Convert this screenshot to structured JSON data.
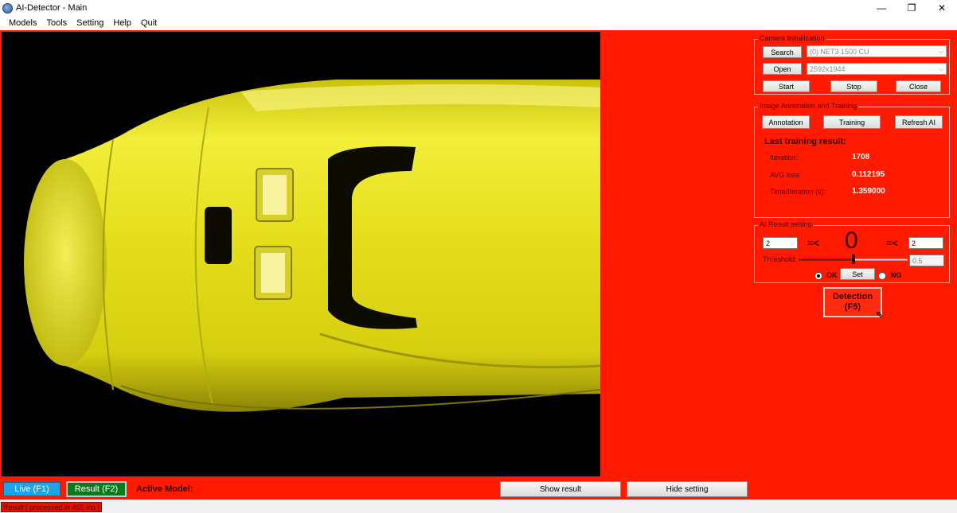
{
  "window": {
    "title": "AI-Detector - Main",
    "minimize": "—",
    "maximize": "❐",
    "close": "✕"
  },
  "menu": [
    "Models",
    "Tools",
    "Setting",
    "Help",
    "Quit"
  ],
  "camera_init": {
    "title": "Camera Initialization",
    "search_label": "Search",
    "open_label": "Open",
    "camera_value": "(0) NET3 1500 CU",
    "resolution_value": "2592x1944",
    "start_label": "Start",
    "stop_label": "Stop",
    "close_label": "Close"
  },
  "annotation": {
    "title": "Image Annotation and Training",
    "annotation_label": "Annotation",
    "training_label": "Training",
    "refresh_label": "Refresh AI",
    "last_result_title": "Last training result:",
    "iteration_label": "Iteration:",
    "iteration_value": "1708",
    "avg_loss_label": "AVG loss:",
    "avg_loss_value": "0.112195",
    "time_label": "Time/Iteration (s):",
    "time_value": "1.359000"
  },
  "ai_result": {
    "title": "AI Result setting",
    "min_value": "2",
    "cmp_left": "=<",
    "count": "0",
    "cmp_right": "=<",
    "max_value": "2",
    "threshold_label": "Threshold:",
    "threshold_value": "0.5",
    "threshold_fraction": 0.5,
    "ok_label": "OK",
    "set_label": "Set",
    "ng_label": "NG"
  },
  "detection": {
    "line1": "Detection",
    "line2": "(F5)"
  },
  "bottom": {
    "live_label": "Live (F1)",
    "result_label": "Result (F2)",
    "active_model_label": "Active Model:",
    "show_result_label": "Show result",
    "hide_setting_label": "Hide setting"
  },
  "status": {
    "text": "Result [ processed in 465 ms ]"
  },
  "colors": {
    "background": "#ff1a00",
    "live": "#1fa3e6",
    "result": "#0b7a1c"
  }
}
